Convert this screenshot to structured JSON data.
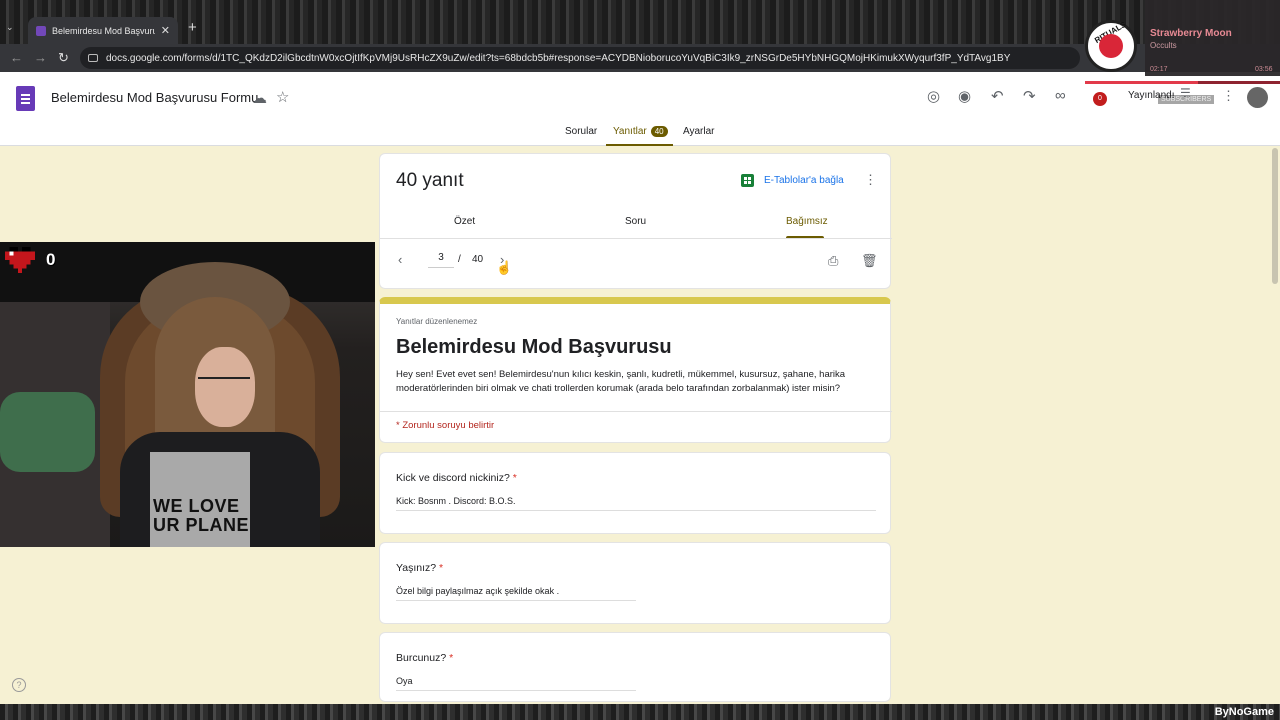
{
  "browser": {
    "tab_title": "Belemirdesu Mod Başvurusu Fo",
    "url": "docs.google.com/forms/d/1TC_QKdzD2ilGbcdtnW0xcOjtIfKpVMj9UsRHcZX9uZw/edit?ts=68bdcb5b#response=ACYDBNioborucoYuVqBiC3Ik9_zrNSGrDe5HYbNHGQMojHKimukXWyqurf3fP_YdTAvg1BY"
  },
  "header": {
    "doc_title": "Belemirdesu Mod Başvurusu Formu",
    "publish_label": "Yayınlandı",
    "rec_count": "0",
    "tabs": [
      {
        "label": "Sorular"
      },
      {
        "label": "Yanıtlar",
        "badge": "40"
      },
      {
        "label": "Ayarlar"
      }
    ]
  },
  "responses": {
    "count_title": "40 yanıt",
    "sheets_link": "E-Tablolar'a bağla",
    "view_tabs": [
      {
        "label": "Özet"
      },
      {
        "label": "Soru"
      },
      {
        "label": "Bağımsız"
      }
    ],
    "current_page": "3",
    "separator": "/",
    "total_pages": "40"
  },
  "form": {
    "note": "Yanıtlar düzenlenemez",
    "title": "Belemirdesu Mod Başvurusu",
    "description": "Hey sen! Evet evet sen! Belemirdesu'nun kılıcı keskin, şanlı, kudretli, mükemmel, kusursuz, şahane, harika moderatörlerinden biri olmak ve chati trollerden korumak (arada belo tarafından zorbalanmak) ister misin?",
    "required_note": "* Zorunlu soruyu belirtir"
  },
  "questions": [
    {
      "label": "Kick ve discord nickiniz?",
      "required": "*",
      "answer": "Kick: Bosnm .   Discord: B.O.S."
    },
    {
      "label": "Yaşınız?",
      "required": "*",
      "answer": "Özel bilgi paylaşılmaz açık şekilde okak ."
    },
    {
      "label": "Burcunuz?",
      "required": "*",
      "answer": "Oya"
    }
  ],
  "overlay": {
    "heart_count": "0",
    "shirt_text_1": "WE LOVE",
    "shirt_text_2": "UR PLANE",
    "song_title": "Strawberry Moon",
    "artist": "Occults",
    "time_elapsed": "02:17",
    "time_total": "03:56",
    "progress_fraction": 0.58,
    "disc_label": "RITUALS",
    "subscribers_label": "SUBSCRIBERS",
    "watermark": "ByNoGame"
  },
  "colors": {
    "accent": "#6b5b00",
    "page_bg": "#f6f1d3",
    "form_border": "#d8c84e",
    "required": "#d93025",
    "link": "#1a73e8",
    "forms_purple": "#673ab7"
  }
}
